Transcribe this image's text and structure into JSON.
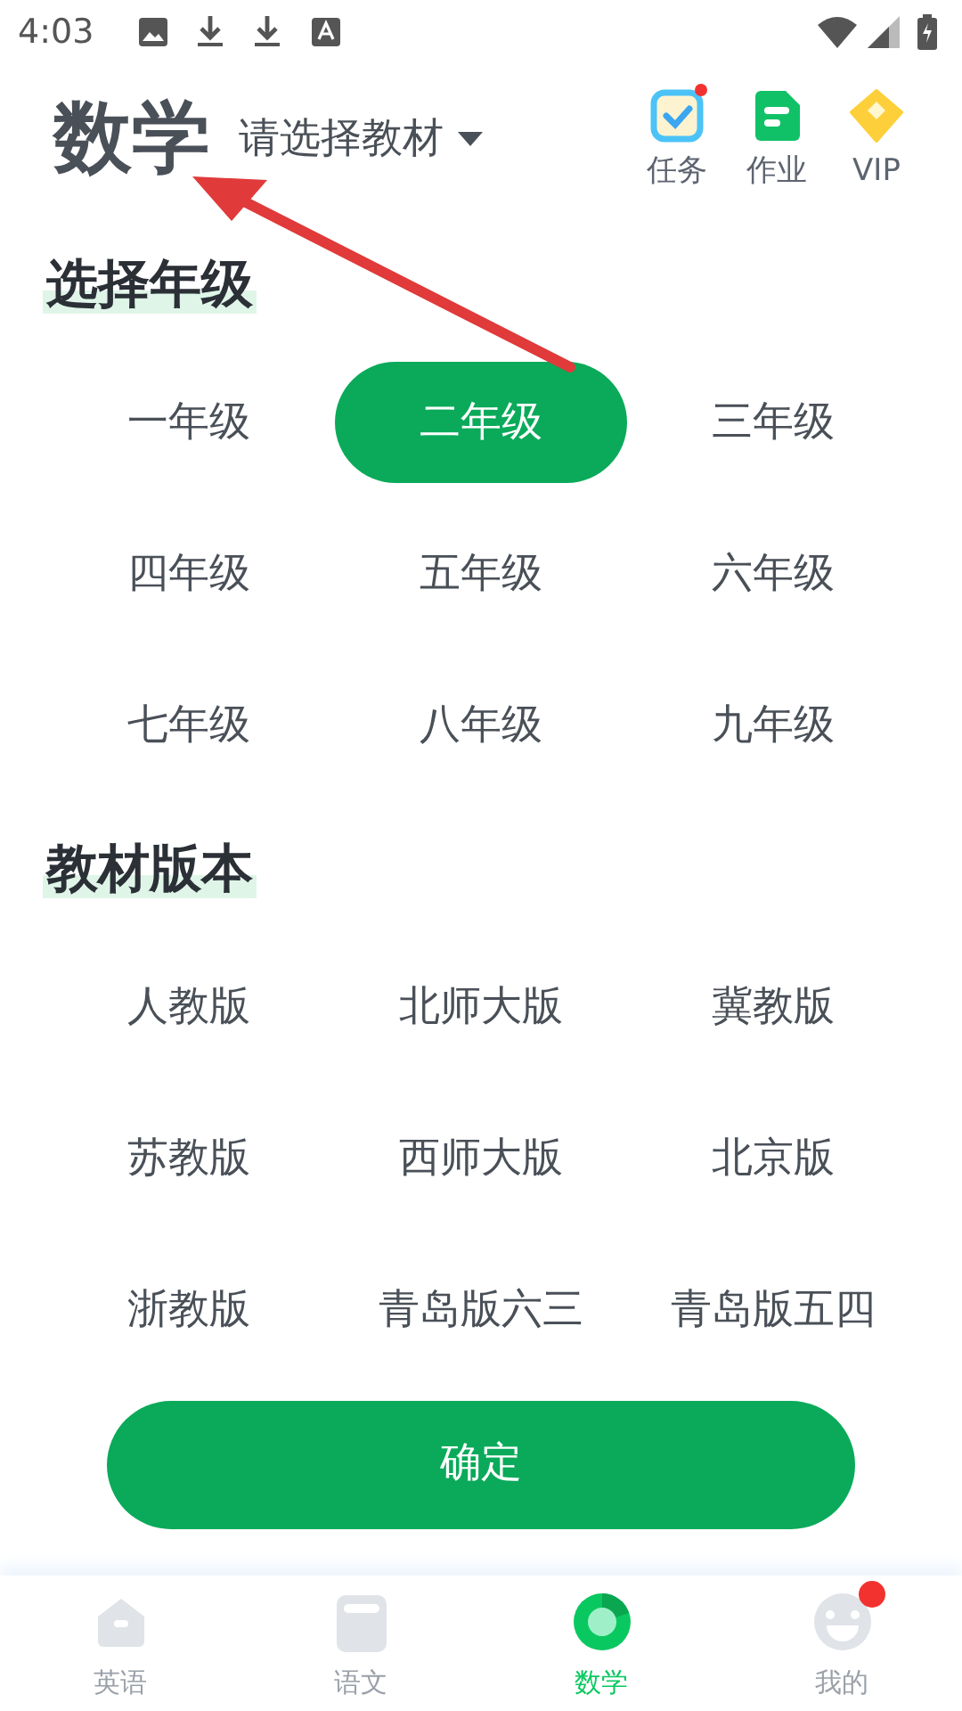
{
  "status_bar": {
    "time": "4:03"
  },
  "header": {
    "subject": "数学",
    "textbook_picker": "请选择教材",
    "actions": [
      {
        "kind": "task",
        "label": "任务",
        "badge": true
      },
      {
        "kind": "homework",
        "label": "作业",
        "badge": false
      },
      {
        "kind": "vip",
        "label": "VIP",
        "badge": false
      }
    ]
  },
  "grade_section": {
    "title": "选择年级",
    "options": [
      {
        "label": "一年级",
        "selected": false
      },
      {
        "label": "二年级",
        "selected": true
      },
      {
        "label": "三年级",
        "selected": false
      },
      {
        "label": "四年级",
        "selected": false
      },
      {
        "label": "五年级",
        "selected": false
      },
      {
        "label": "六年级",
        "selected": false
      },
      {
        "label": "七年级",
        "selected": false
      },
      {
        "label": "八年级",
        "selected": false
      },
      {
        "label": "九年级",
        "selected": false
      }
    ]
  },
  "edition_section": {
    "title": "教材版本",
    "options": [
      {
        "label": "人教版",
        "selected": false
      },
      {
        "label": "北师大版",
        "selected": false
      },
      {
        "label": "冀教版",
        "selected": false
      },
      {
        "label": "苏教版",
        "selected": false
      },
      {
        "label": "西师大版",
        "selected": false
      },
      {
        "label": "北京版",
        "selected": false
      },
      {
        "label": "浙教版",
        "selected": false
      },
      {
        "label": "青岛版六三",
        "selected": false
      },
      {
        "label": "青岛版五四",
        "selected": false
      }
    ]
  },
  "confirm_button": "确定",
  "tab_bar": [
    {
      "kind": "home",
      "label": "英语",
      "selected": false,
      "badge": false
    },
    {
      "kind": "book",
      "label": "语文",
      "selected": false,
      "badge": false
    },
    {
      "kind": "math",
      "label": "数学",
      "selected": true,
      "badge": false
    },
    {
      "kind": "face",
      "label": "我的",
      "selected": false,
      "badge": true
    }
  ]
}
